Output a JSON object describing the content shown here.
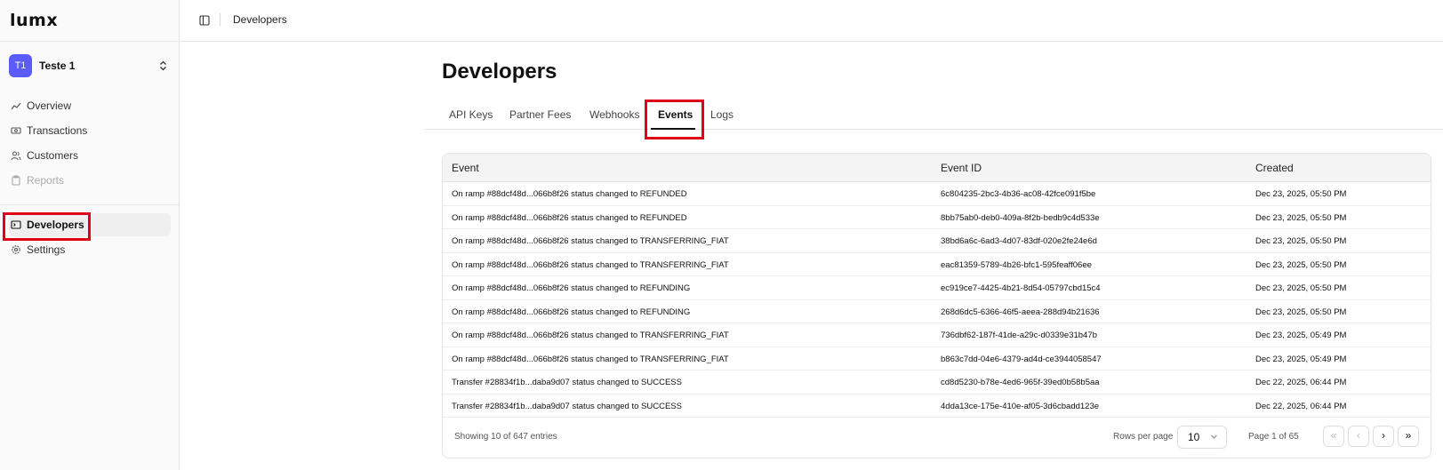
{
  "app": {
    "logo": "lumx"
  },
  "org": {
    "initials": "T1",
    "name": "Teste 1"
  },
  "sidebar": {
    "items": [
      {
        "label": "Overview",
        "icon": "chart-icon"
      },
      {
        "label": "Transactions",
        "icon": "cash-icon"
      },
      {
        "label": "Customers",
        "icon": "users-icon"
      },
      {
        "label": "Reports",
        "icon": "clipboard-icon",
        "disabled": true
      },
      {
        "label": "Developers",
        "icon": "terminal-icon",
        "active": true
      },
      {
        "label": "Settings",
        "icon": "gear-icon"
      }
    ]
  },
  "topbar": {
    "breadcrumb": "Developers"
  },
  "page": {
    "title": "Developers"
  },
  "tabs": [
    {
      "label": "API Keys"
    },
    {
      "label": "Partner Fees"
    },
    {
      "label": "Webhooks"
    },
    {
      "label": "Events",
      "active": true
    },
    {
      "label": "Logs"
    }
  ],
  "table": {
    "columns": [
      "Event",
      "Event ID",
      "Created"
    ],
    "rows": [
      [
        "On ramp #88dcf48d...066b8f26 status changed to REFUNDED",
        "6c804235-2bc3-4b36-ac08-42fce091f5be",
        "Dec 23, 2025, 05:50 PM"
      ],
      [
        "On ramp #88dcf48d...066b8f26 status changed to REFUNDED",
        "8bb75ab0-deb0-409a-8f2b-bedb9c4d533e",
        "Dec 23, 2025, 05:50 PM"
      ],
      [
        "On ramp #88dcf48d...066b8f26 status changed to TRANSFERRING_FIAT",
        "38bd6a6c-6ad3-4d07-83df-020e2fe24e6d",
        "Dec 23, 2025, 05:50 PM"
      ],
      [
        "On ramp #88dcf48d...066b8f26 status changed to TRANSFERRING_FIAT",
        "eac81359-5789-4b26-bfc1-595feaff06ee",
        "Dec 23, 2025, 05:50 PM"
      ],
      [
        "On ramp #88dcf48d...066b8f26 status changed to REFUNDING",
        "ec919ce7-4425-4b21-8d54-05797cbd15c4",
        "Dec 23, 2025, 05:50 PM"
      ],
      [
        "On ramp #88dcf48d...066b8f26 status changed to REFUNDING",
        "268d6dc5-6366-46f5-aeea-288d94b21636",
        "Dec 23, 2025, 05:50 PM"
      ],
      [
        "On ramp #88dcf48d...066b8f26 status changed to TRANSFERRING_FIAT",
        "736dbf62-187f-41de-a29c-d0339e31b47b",
        "Dec 23, 2025, 05:49 PM"
      ],
      [
        "On ramp #88dcf48d...066b8f26 status changed to TRANSFERRING_FIAT",
        "b863c7dd-04e6-4379-ad4d-ce3944058547",
        "Dec 23, 2025, 05:49 PM"
      ],
      [
        "Transfer #28834f1b...daba9d07 status changed to SUCCESS",
        "cd8d5230-b78e-4ed6-965f-39ed0b58b5aa",
        "Dec 22, 2025, 06:44 PM"
      ],
      [
        "Transfer #28834f1b...daba9d07 status changed to SUCCESS",
        "4dda13ce-175e-410e-af05-3d6cbadd123e",
        "Dec 22, 2025, 06:44 PM"
      ]
    ],
    "showing": "Showing 10 of 647 entries",
    "rows_per_page_label": "Rows per page",
    "rows_per_page_value": "10",
    "page_info": "Page 1 of 65",
    "pager": {
      "first": "«",
      "prev": "‹",
      "next": "›",
      "last": "»"
    }
  },
  "colors": {
    "avatar": "#5b5bf6",
    "highlight": "#e0001a"
  }
}
